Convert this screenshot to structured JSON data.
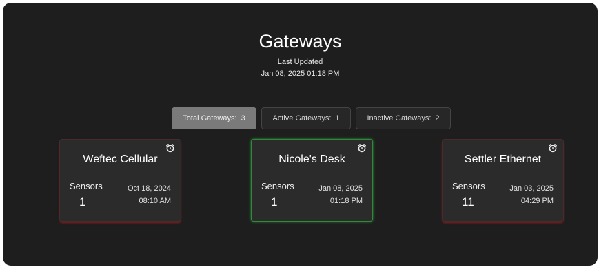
{
  "header": {
    "title": "Gateways",
    "last_updated_label": "Last Updated",
    "last_updated_value": "Jan 08, 2025 01:18 PM"
  },
  "filters": [
    {
      "label": "Total Gateways:",
      "count": "3",
      "selected": true
    },
    {
      "label": "Active Gateways:",
      "count": "1",
      "selected": false
    },
    {
      "label": "Inactive Gateways:",
      "count": "2",
      "selected": false
    }
  ],
  "gateways": [
    {
      "name": "Weftec Cellular",
      "sensors_label": "Sensors",
      "sensors": "1",
      "date": "Oct 18, 2024",
      "time": "08:10 AM",
      "status": "inactive",
      "icon": "alarm-clock-icon"
    },
    {
      "name": "Nicole's Desk",
      "sensors_label": "Sensors",
      "sensors": "1",
      "date": "Jan 08, 2025",
      "time": "01:18 PM",
      "status": "active",
      "icon": "alarm-clock-icon"
    },
    {
      "name": "Settler Ethernet",
      "sensors_label": "Sensors",
      "sensors": "11",
      "date": "Jan 03, 2025",
      "time": "04:29 PM",
      "status": "inactive",
      "icon": "alarm-clock-icon"
    }
  ],
  "colors": {
    "background": "#1e1e1e",
    "card": "#2b2b2b",
    "active": "#2f8a3a",
    "inactive": "#8a1f1f",
    "selected_filter": "#7a7a7a"
  }
}
